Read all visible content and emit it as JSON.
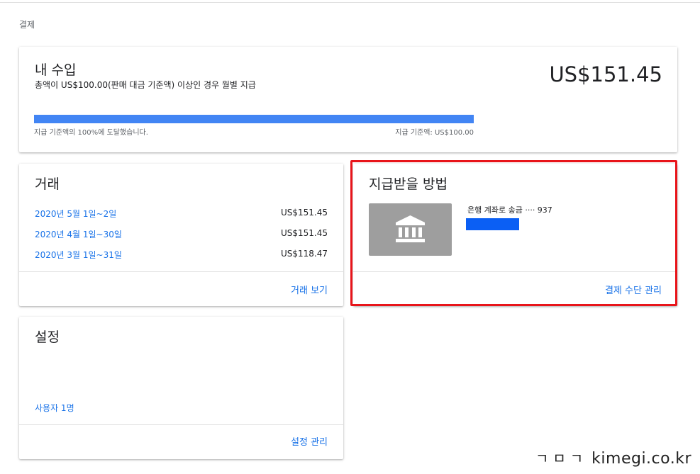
{
  "breadcrumb": "결제",
  "earnings": {
    "title": "내 수입",
    "subtitle": "총액이 US$100.00(판매 대금 기준액) 이상인 경우 월별 지급",
    "amount": "US$151.45",
    "progress_percent": 100,
    "progress_left": "지급 기준액의 100%에 도달했습니다.",
    "progress_right": "지급 기준액: US$100.00",
    "progress_color": "#4285f4"
  },
  "transactions": {
    "title": "거래",
    "rows": [
      {
        "date": "2020년 5월 1일~2일",
        "amount": "US$151.45"
      },
      {
        "date": "2020년 4월 1일~30일",
        "amount": "US$151.45"
      },
      {
        "date": "2020년 3월 1일~31일",
        "amount": "US$118.47"
      }
    ],
    "footer_link": "거래 보기"
  },
  "payment": {
    "title": "지급받을 방법",
    "method_icon": "bank-icon",
    "method_label": "은행 계좌로 송금 ···· 937",
    "footer_link": "결제 수단 관리",
    "highlight_color": "#e8141a"
  },
  "settings": {
    "title": "설정",
    "users_link": "사용자 1명",
    "footer_link": "설정 관리"
  },
  "watermark": {
    "prefix": "ㄱㅁㄱ",
    "site": "kimegi.co.kr"
  },
  "colors": {
    "link": "#1a73e8",
    "redaction": "#0b5ff4"
  }
}
